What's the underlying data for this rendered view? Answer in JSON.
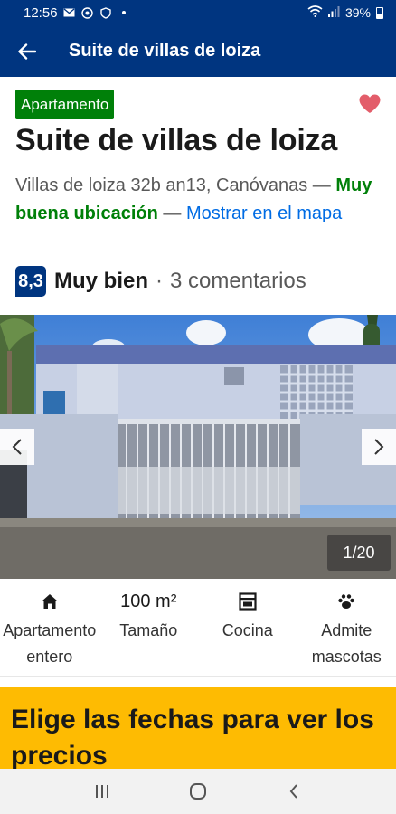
{
  "status_bar": {
    "time": "12:56",
    "battery": "39%",
    "icons": [
      "mail-icon",
      "whatsapp-icon",
      "shield-icon",
      "dot-icon",
      "wifi-icon",
      "signal-icon",
      "battery-icon"
    ]
  },
  "app_bar": {
    "title": "Suite de villas de loiza",
    "back_icon": "arrow-left-icon"
  },
  "property": {
    "type_badge": "Apartamento",
    "title": "Suite de villas de loiza",
    "address": "Villas de loiza 32b an13, Canóvanas —",
    "location_quality": "Muy buena ubicación",
    "separator": "—",
    "map_link": "Mostrar en el mapa",
    "score": "8,3",
    "rating_word": "Muy bien",
    "rating_dot": "·",
    "reviews": "3 comentarios",
    "favorite_icon": "heart-icon",
    "favorite_color": "#e35d6a"
  },
  "gallery": {
    "counter": "1/20",
    "prev_icon": "chevron-left-icon",
    "next_icon": "chevron-right-icon"
  },
  "facilities": [
    {
      "icon": "house-icon",
      "label": "Apartamento entero"
    },
    {
      "value": "100 m²",
      "label": "Tamaño"
    },
    {
      "icon": "stove-icon",
      "label": "Cocina"
    },
    {
      "icon": "paw-icon",
      "label": "Admite mascotas"
    }
  ],
  "date_banner": {
    "text": "Elige las fechas para ver los precios",
    "color": "#febb02"
  },
  "colors": {
    "brand": "#003580",
    "green": "#008009",
    "link": "#006ce4"
  }
}
